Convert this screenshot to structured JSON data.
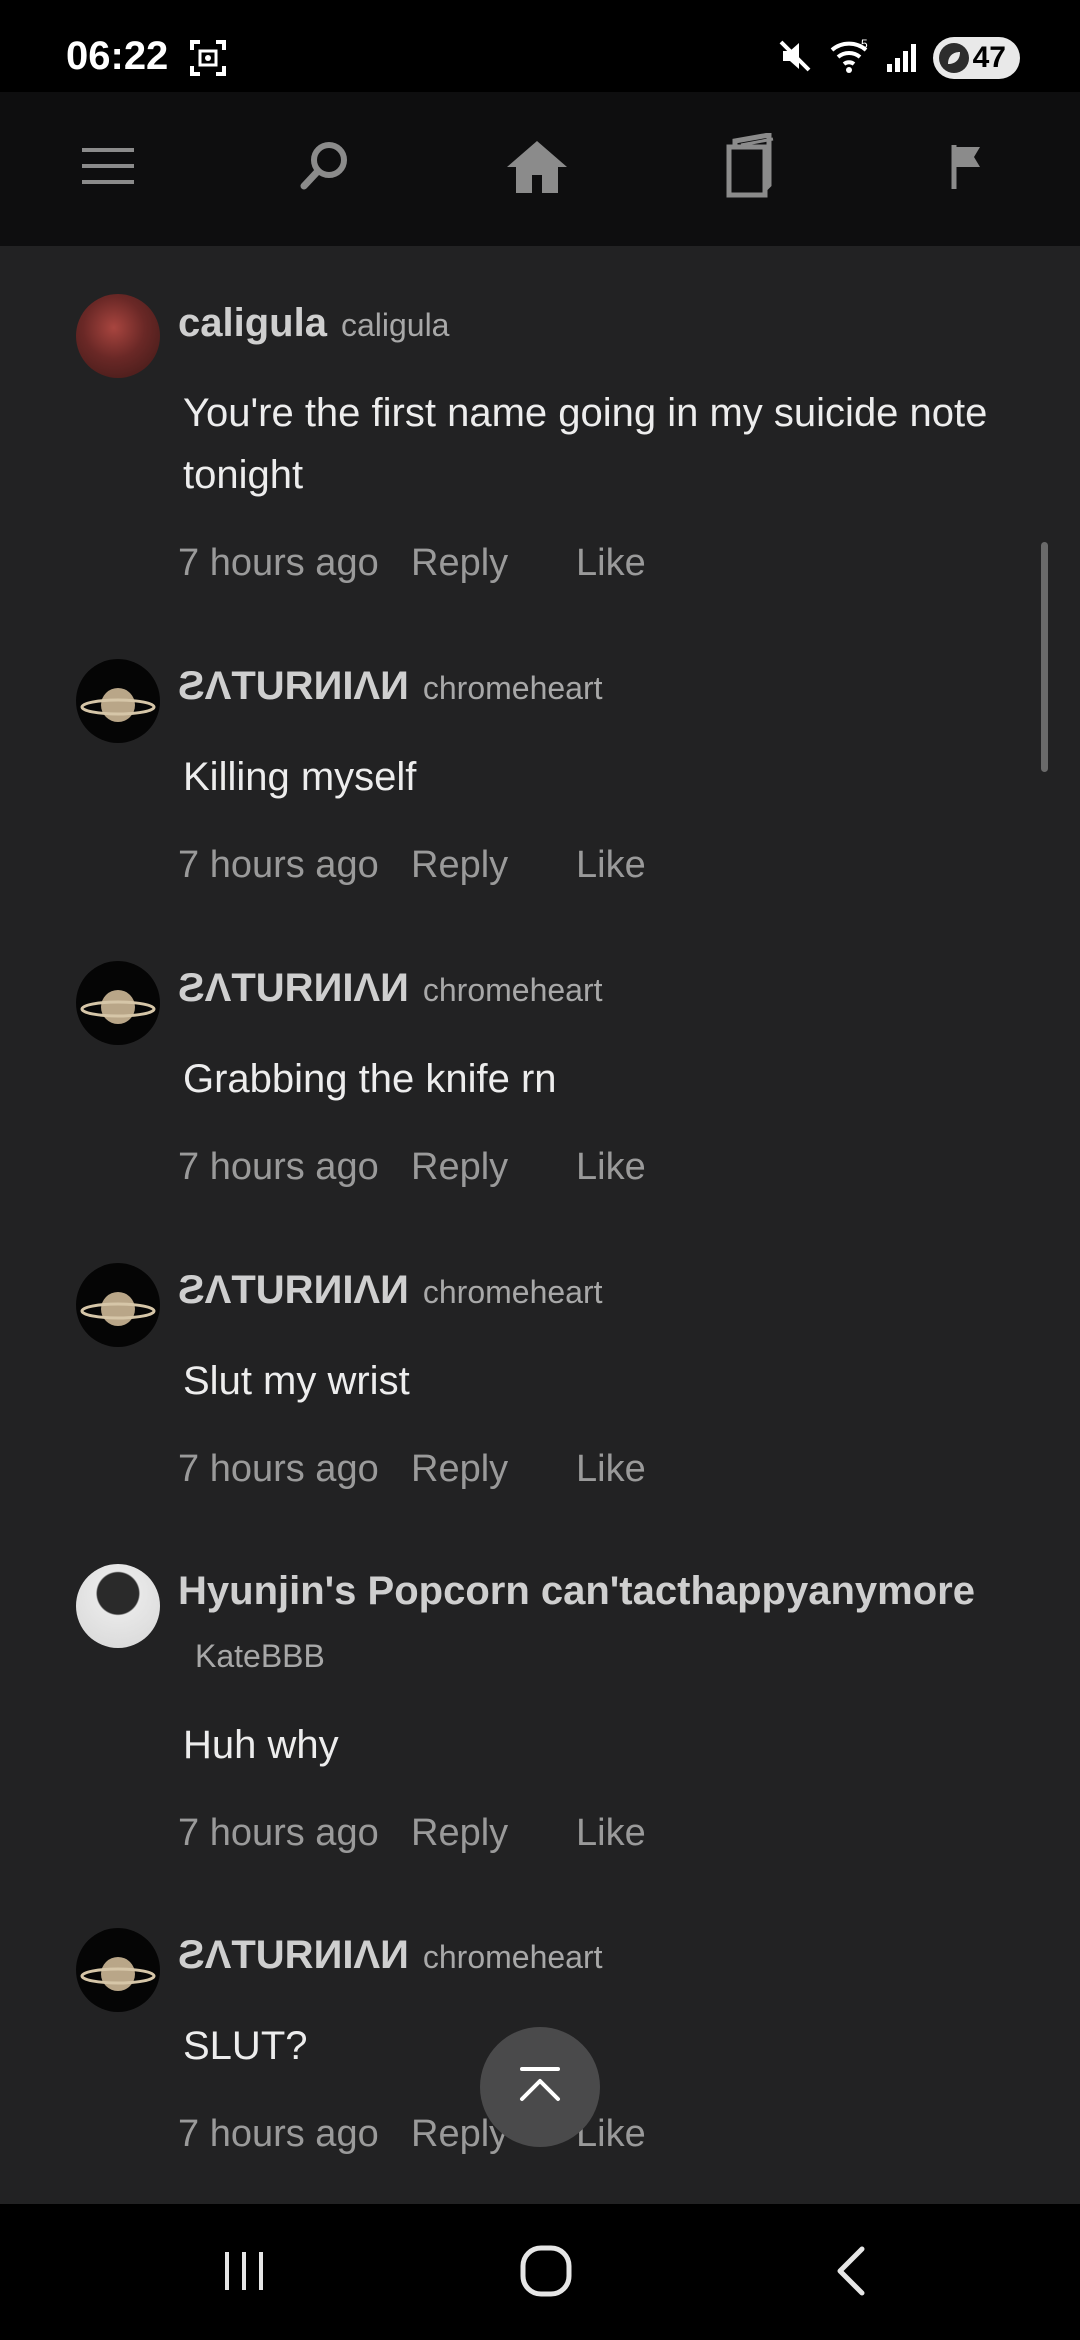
{
  "status_bar": {
    "time": "06:22",
    "battery": "47",
    "icons": [
      "screenshot-icon",
      "mute-icon",
      "wifi-icon",
      "signal-icon",
      "battery-icon"
    ]
  },
  "nav": {
    "icons": [
      "menu-icon",
      "search-icon",
      "home-icon",
      "library-icon",
      "flag-icon"
    ]
  },
  "comments": [
    {
      "author": "caligula",
      "handle": "caligula",
      "text": "You're the first name going in my suicide note tonight",
      "time": "7 hours ago",
      "reply": "Reply",
      "like": "Like"
    },
    {
      "author": "ƧΛTURИIΛИ",
      "handle": "chromeheart",
      "text": "Killing myself",
      "time": "7 hours ago",
      "reply": "Reply",
      "like": "Like"
    },
    {
      "author": "ƧΛTURИIΛИ",
      "handle": "chromeheart",
      "text": "Grabbing the knife rn",
      "time": "7 hours ago",
      "reply": "Reply",
      "like": "Like"
    },
    {
      "author": "ƧΛTURИIΛИ",
      "handle": "chromeheart",
      "text": "Slut my wrist",
      "time": "7 hours ago",
      "reply": "Reply",
      "like": "Like"
    },
    {
      "author": "Hyunjin's Popcorn can'tacthappyanymore",
      "handle": "KateBBB",
      "text": "Huh why",
      "time": "7 hours ago",
      "reply": "Reply",
      "like": "Like"
    },
    {
      "author": "ƧΛTURИIΛИ",
      "handle": "chromeheart",
      "text": "SLUT?",
      "time": "7 hours ago",
      "reply": "Reply",
      "like": "Like"
    }
  ],
  "colors": {
    "background": "#222223",
    "nav_bar": "#0e0e0f",
    "text": "#ededed",
    "muted": "#9a9a9a"
  }
}
